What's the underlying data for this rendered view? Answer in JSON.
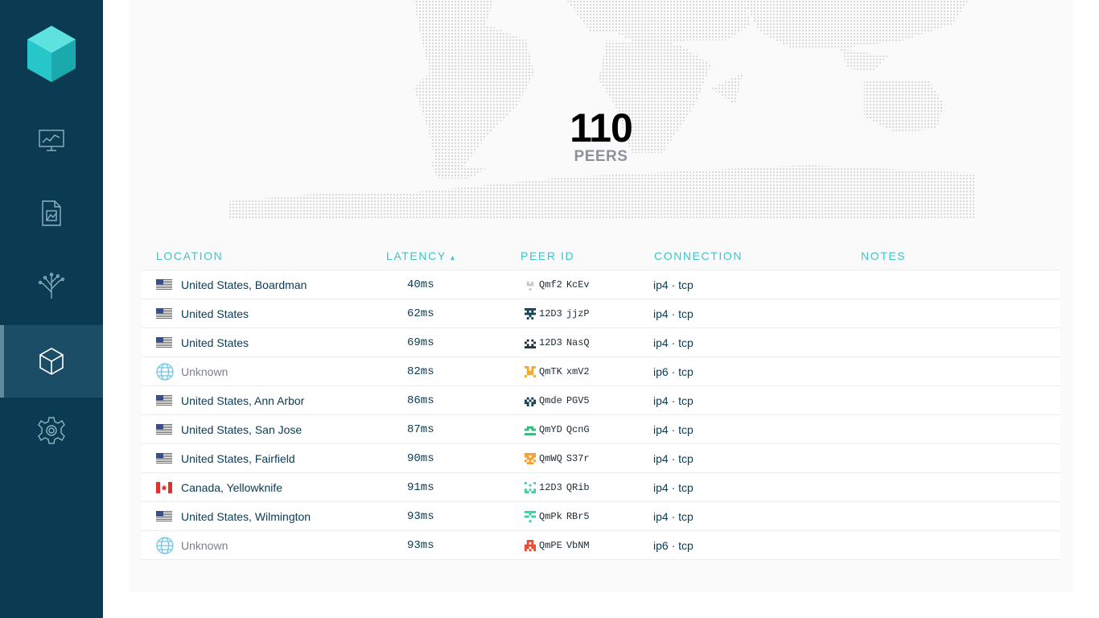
{
  "sidebar": {
    "items": [
      {
        "name": "status",
        "icon": "monitor-chart-icon"
      },
      {
        "name": "files",
        "icon": "document-icon"
      },
      {
        "name": "explore",
        "icon": "tree-icon"
      },
      {
        "name": "peers",
        "icon": "cube-icon",
        "active": true
      },
      {
        "name": "settings",
        "icon": "gear-icon"
      }
    ]
  },
  "peers": {
    "count": "110",
    "label": "PEERS"
  },
  "table": {
    "headers": {
      "location": "LOCATION",
      "latency": "LATENCY",
      "sort_arrow": "▴",
      "peer_id": "PEER ID",
      "connection": "CONNECTION",
      "notes": "NOTES"
    },
    "rows": [
      {
        "location": "United States, Boardman",
        "flag": "us",
        "latency": "40ms",
        "peer_prefix": "Qmf2",
        "peer_suffix": "KcEv",
        "connection": "ip4 · tcp",
        "ident_color": "#c6c6c6"
      },
      {
        "location": "United States",
        "flag": "us",
        "latency": "62ms",
        "peer_prefix": "12D3",
        "peer_suffix": "jjzP",
        "connection": "ip4 · tcp",
        "ident_color": "#0b3a53"
      },
      {
        "location": "United States",
        "flag": "us",
        "latency": "69ms",
        "peer_prefix": "12D3",
        "peer_suffix": "NasQ",
        "connection": "ip4 · tcp",
        "ident_color": "#1b2a33"
      },
      {
        "location": "Unknown",
        "flag": "unknown",
        "latency": "82ms",
        "peer_prefix": "QmTK",
        "peer_suffix": "xmV2",
        "connection": "ip6 · tcp",
        "ident_color": "#f5a623"
      },
      {
        "location": "United States, Ann Arbor",
        "flag": "us",
        "latency": "86ms",
        "peer_prefix": "Qmde",
        "peer_suffix": "PGV5",
        "connection": "ip4 · tcp",
        "ident_color": "#0b3a53"
      },
      {
        "location": "United States, San Jose",
        "flag": "us",
        "latency": "87ms",
        "peer_prefix": "QmYD",
        "peer_suffix": "QcnG",
        "connection": "ip4 · tcp",
        "ident_color": "#2fb573"
      },
      {
        "location": "United States, Fairfield",
        "flag": "us",
        "latency": "90ms",
        "peer_prefix": "QmWQ",
        "peer_suffix": "S37r",
        "connection": "ip4 · tcp",
        "ident_color": "#f59d23"
      },
      {
        "location": "Canada, Yellowknife",
        "flag": "ca",
        "latency": "91ms",
        "peer_prefix": "12D3",
        "peer_suffix": "QRib",
        "connection": "ip4 · tcp",
        "ident_color": "#3ec9a0"
      },
      {
        "location": "United States, Wilmington",
        "flag": "us",
        "latency": "93ms",
        "peer_prefix": "QmPk",
        "peer_suffix": "RBr5",
        "connection": "ip4 · tcp",
        "ident_color": "#2bd19d"
      },
      {
        "location": "Unknown",
        "flag": "unknown",
        "latency": "93ms",
        "peer_prefix": "QmPE",
        "peer_suffix": "VbNM",
        "connection": "ip6 · tcp",
        "ident_color": "#e8432b"
      }
    ]
  },
  "colors": {
    "sidebar_bg": "#0b3a53",
    "sidebar_active": "#1b4d66",
    "accent_teal": "#3dc5c9",
    "text_navy": "#0b3a53"
  }
}
